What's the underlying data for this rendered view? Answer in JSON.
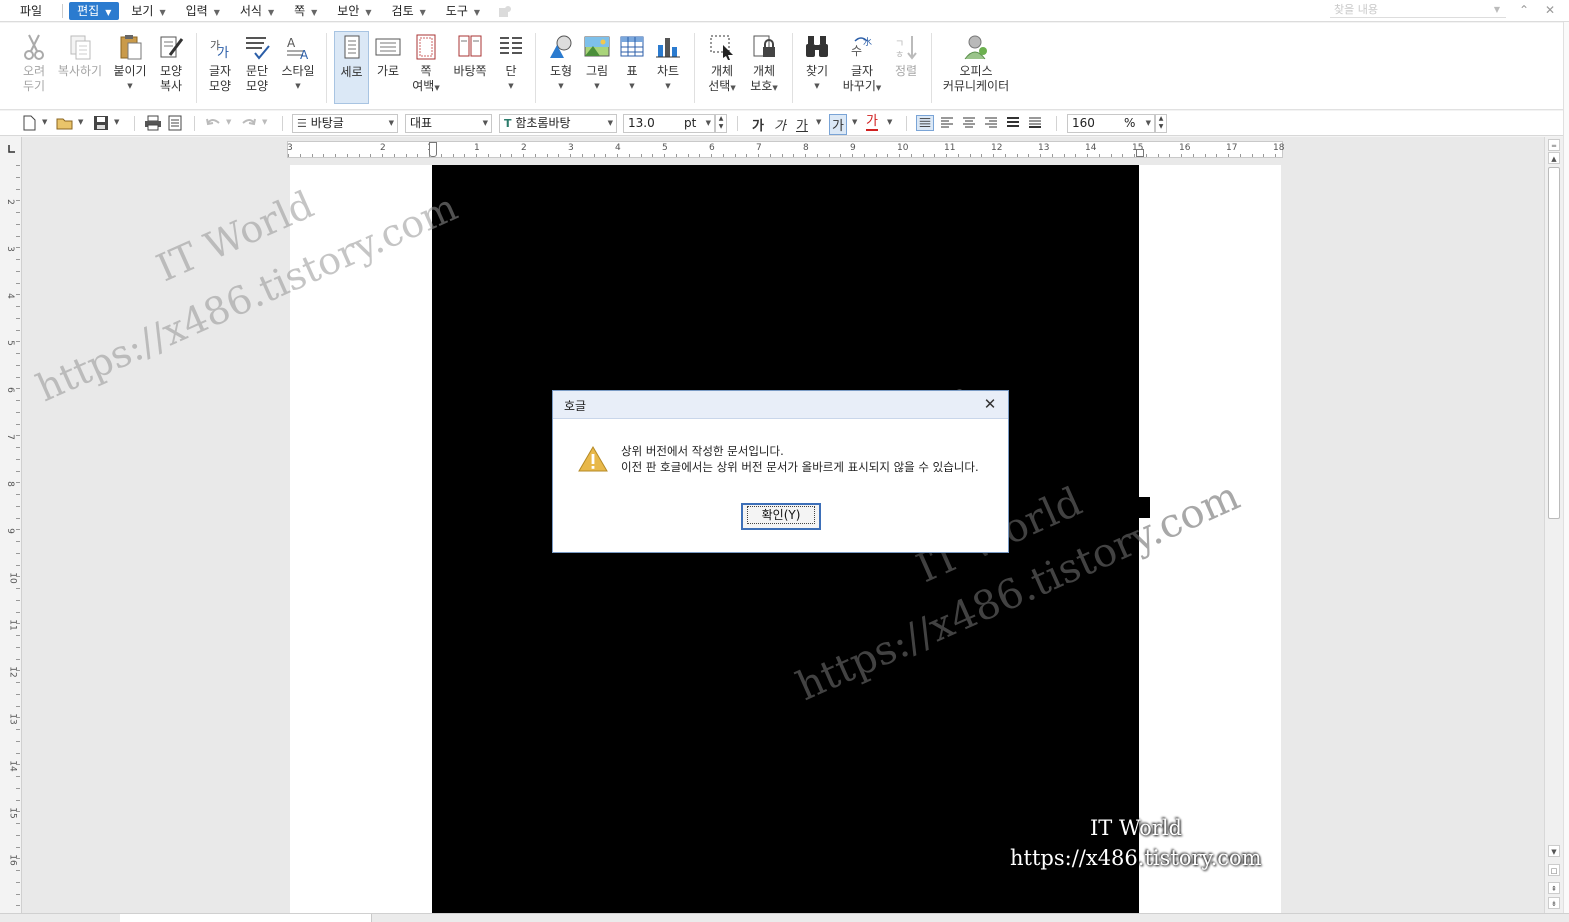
{
  "menubar": {
    "items": [
      {
        "label": "파일"
      },
      {
        "label": "편집"
      },
      {
        "label": "보기"
      },
      {
        "label": "입력"
      },
      {
        "label": "서식"
      },
      {
        "label": "쪽"
      },
      {
        "label": "보안"
      },
      {
        "label": "검토"
      },
      {
        "label": "도구"
      }
    ],
    "search_placeholder": "찾을 내용"
  },
  "ribbon": {
    "cut": [
      "오려",
      "두기"
    ],
    "copy": "복사하기",
    "paste": "붙이기",
    "format_copy": [
      "모양",
      "복사"
    ],
    "char_shape": [
      "글자",
      "모양"
    ],
    "para_shape": [
      "문단",
      "모양"
    ],
    "style": "스타일",
    "portrait": "세로",
    "landscape": "가로",
    "page_margin": [
      "쪽",
      "여백"
    ],
    "master_page": "바탕쪽",
    "columns": "단",
    "shape": "도형",
    "picture": "그림",
    "table": "표",
    "chart": "차트",
    "object_select": [
      "개체",
      "선택"
    ],
    "object_protect": [
      "개체",
      "보호"
    ],
    "find": "찾기",
    "replace": [
      "글자",
      "바꾸기"
    ],
    "sort": "정렬",
    "office_comm": [
      "오피스",
      "커뮤니케이터"
    ]
  },
  "toolbar": {
    "style_name": "바탕글",
    "lang": "대표",
    "font_name": "함초롬바탕",
    "font_size": "13.0",
    "font_unit": "pt",
    "bold": "가",
    "italic": "가",
    "underline": "가",
    "highlight": "가",
    "font_color": "가",
    "zoom": "160",
    "zoom_unit": "%"
  },
  "ruler": {
    "h_numbers": [
      "3",
      "2",
      "1",
      "1",
      "2",
      "3",
      "4",
      "5",
      "6",
      "7",
      "8",
      "9",
      "10",
      "11",
      "12",
      "13",
      "14",
      "15",
      "16",
      "17",
      "18"
    ],
    "v_numbers": [
      "2",
      "3",
      "4",
      "5",
      "6",
      "7",
      "8",
      "9",
      "10",
      "11",
      "12",
      "13",
      "14",
      "15",
      "16"
    ]
  },
  "watermark": {
    "name": "IT World",
    "url": "https://x486.tistory.com"
  },
  "dialog": {
    "title": "호글",
    "line1": "상위 버전에서 작성한 문서입니다.",
    "line2": "이전 판 호글에서는 상위 버전 문서가 올바르게 표시되지 않을 수 있습니다.",
    "ok_label": "확인(Y)"
  },
  "colors": {
    "accent": "#2b7bcf",
    "warning": "#e8b84a"
  }
}
